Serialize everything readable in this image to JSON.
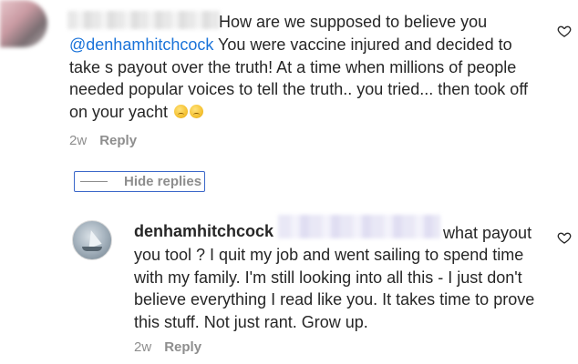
{
  "comment": {
    "first_line": "How are we supposed to believe you",
    "mention": "@denhamhitchcock",
    "body_after_mention": " You were vaccine injured and decided to take s payout over the truth! At a time when millions of people needed popular voices to tell the truth.. you tried... then took off on your yacht ",
    "time": "2w",
    "reply_label": "Reply"
  },
  "thread": {
    "hide_replies_label": "Hide replies"
  },
  "reply": {
    "username": "denhamhitchcock",
    "first_line": "what payout",
    "body": "you tool ? I quit my job and went sailing to spend time with my family. I'm still looking into all this - I just don't believe everything I read like you. It takes time to prove this stuff. Not just rant. Grow up.",
    "time": "2w",
    "reply_label": "Reply"
  },
  "icons": {
    "like": "heart-outline-icon",
    "emoji": "crying-face-emoji"
  },
  "colors": {
    "mention": "#1a73d9",
    "meta": "#8e8e8e",
    "highlight_border": "#3b67c9"
  }
}
